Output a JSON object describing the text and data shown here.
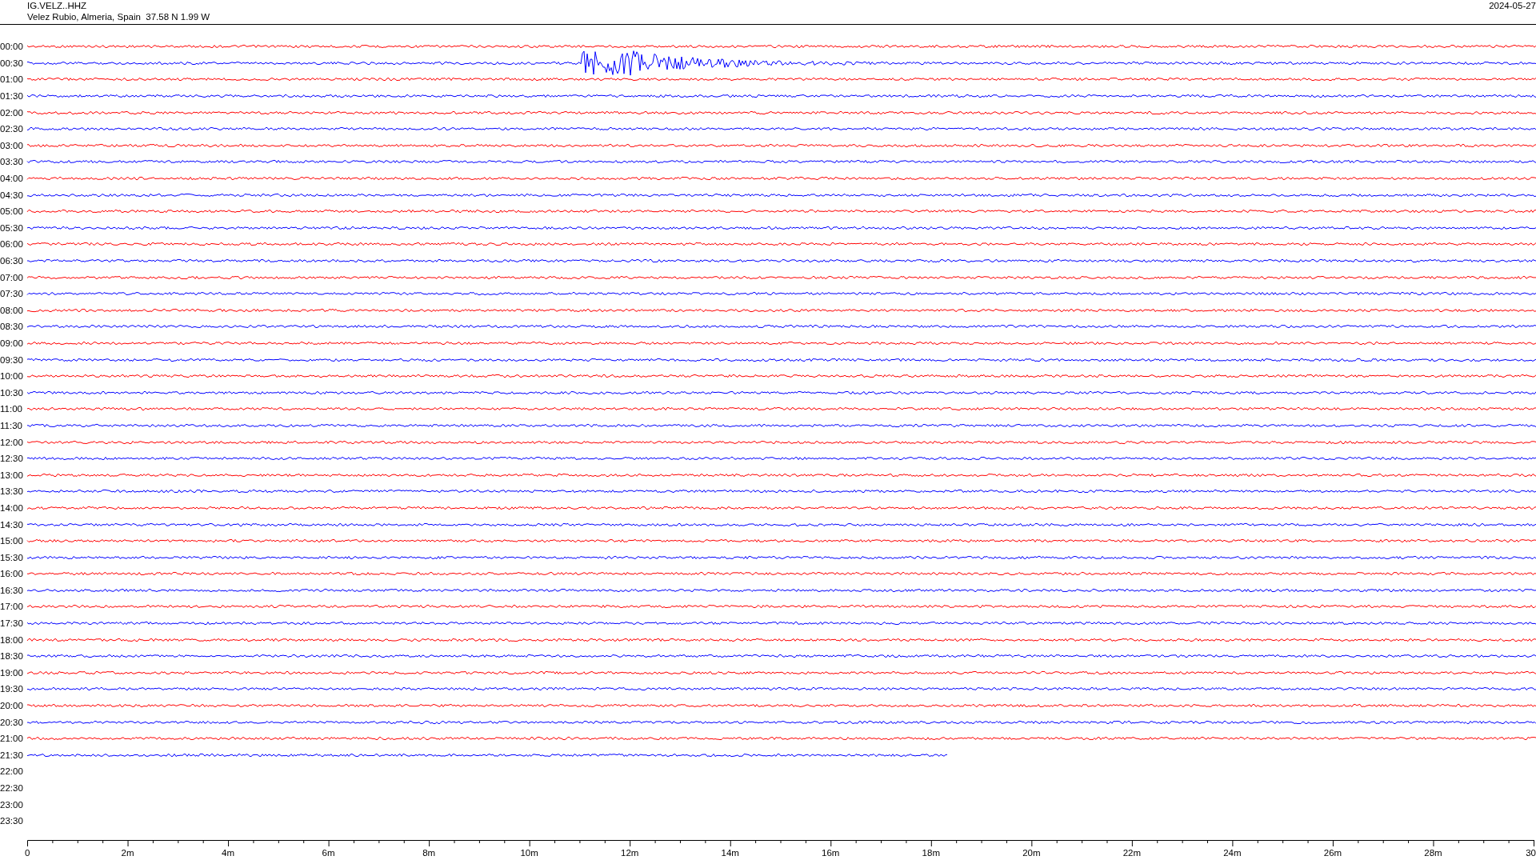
{
  "header": {
    "station": "IG.VELZ..HHZ",
    "location": "Velez Rubio, Almeria, Spain  37.58 N 1.99 W",
    "date": "2024-05-27"
  },
  "rows": [
    {
      "time": "00:00",
      "trace": {
        "color": "#ff0000",
        "level": 1,
        "event": false
      }
    },
    {
      "time": "00:30",
      "trace": {
        "color": "#0000ff",
        "level": 1,
        "event": true
      }
    },
    {
      "time": "01:00",
      "trace": {
        "color": "#ff0000",
        "level": 1,
        "event": false
      }
    },
    {
      "time": "01:30",
      "trace": {
        "color": "#0000ff",
        "level": 1,
        "event": false
      }
    },
    {
      "time": "02:00",
      "trace": {
        "color": "#ff0000",
        "level": 1,
        "event": false
      }
    },
    {
      "time": "02:30",
      "trace": {
        "color": "#0000ff",
        "level": 1,
        "event": false
      }
    },
    {
      "time": "03:00",
      "trace": {
        "color": "#ff0000",
        "level": 1,
        "event": false
      }
    },
    {
      "time": "03:30",
      "trace": {
        "color": "#0000ff",
        "level": 1,
        "event": false
      }
    },
    {
      "time": "04:00",
      "trace": {
        "color": "#ff0000",
        "level": 1,
        "event": false
      }
    },
    {
      "time": "04:30",
      "trace": {
        "color": "#0000ff",
        "level": 1,
        "event": false
      }
    },
    {
      "time": "05:00",
      "trace": {
        "color": "#ff0000",
        "level": 1,
        "event": false
      }
    },
    {
      "time": "05:30",
      "trace": {
        "color": "#0000ff",
        "level": 1,
        "event": false
      }
    },
    {
      "time": "06:00",
      "trace": {
        "color": "#ff0000",
        "level": 1,
        "event": false
      }
    },
    {
      "time": "06:30",
      "trace": {
        "color": "#0000ff",
        "level": 1,
        "event": false
      }
    },
    {
      "time": "07:00",
      "trace": {
        "color": "#ff0000",
        "level": 1,
        "event": false
      }
    },
    {
      "time": "07:30",
      "trace": {
        "color": "#0000ff",
        "level": 1,
        "event": false
      }
    },
    {
      "time": "08:00",
      "trace": {
        "color": "#ff0000",
        "level": 1,
        "event": false
      }
    },
    {
      "time": "08:30",
      "trace": {
        "color": "#0000ff",
        "level": 1,
        "event": false
      }
    },
    {
      "time": "09:00",
      "trace": {
        "color": "#ff0000",
        "level": 1,
        "event": false
      }
    },
    {
      "time": "09:30",
      "trace": {
        "color": "#0000ff",
        "level": 1,
        "event": false
      }
    },
    {
      "time": "10:00",
      "trace": {
        "color": "#ff0000",
        "level": 1,
        "event": false
      }
    },
    {
      "time": "10:30",
      "trace": {
        "color": "#0000ff",
        "level": 1,
        "event": false
      }
    },
    {
      "time": "11:00",
      "trace": {
        "color": "#ff0000",
        "level": 1,
        "event": false
      }
    },
    {
      "time": "11:30",
      "trace": {
        "color": "#0000ff",
        "level": 1,
        "event": false
      }
    },
    {
      "time": "12:00",
      "trace": {
        "color": "#ff0000",
        "level": 1,
        "event": false
      }
    },
    {
      "time": "12:30",
      "trace": {
        "color": "#0000ff",
        "level": 1,
        "event": false
      }
    },
    {
      "time": "13:00",
      "trace": {
        "color": "#ff0000",
        "level": 1,
        "event": false
      }
    },
    {
      "time": "13:30",
      "trace": {
        "color": "#0000ff",
        "level": 1,
        "event": false
      }
    },
    {
      "time": "14:00",
      "trace": {
        "color": "#ff0000",
        "level": 1,
        "event": false
      }
    },
    {
      "time": "14:30",
      "trace": {
        "color": "#0000ff",
        "level": 1,
        "event": false
      }
    },
    {
      "time": "15:00",
      "trace": {
        "color": "#ff0000",
        "level": 1,
        "event": false
      }
    },
    {
      "time": "15:30",
      "trace": {
        "color": "#0000ff",
        "level": 1,
        "event": false
      }
    },
    {
      "time": "16:00",
      "trace": {
        "color": "#ff0000",
        "level": 1,
        "event": false
      }
    },
    {
      "time": "16:30",
      "trace": {
        "color": "#0000ff",
        "level": 1,
        "event": false
      }
    },
    {
      "time": "17:00",
      "trace": {
        "color": "#ff0000",
        "level": 1,
        "event": false
      }
    },
    {
      "time": "17:30",
      "trace": {
        "color": "#0000ff",
        "level": 1,
        "event": false
      }
    },
    {
      "time": "18:00",
      "trace": {
        "color": "#ff0000",
        "level": 1,
        "event": false
      }
    },
    {
      "time": "18:30",
      "trace": {
        "color": "#0000ff",
        "level": 1,
        "event": false
      }
    },
    {
      "time": "19:00",
      "trace": {
        "color": "#ff0000",
        "level": 1,
        "event": false
      }
    },
    {
      "time": "19:30",
      "trace": {
        "color": "#0000ff",
        "level": 1,
        "event": false
      }
    },
    {
      "time": "20:00",
      "trace": {
        "color": "#ff0000",
        "level": 1,
        "event": false
      }
    },
    {
      "time": "20:30",
      "trace": {
        "color": "#0000ff",
        "level": 1,
        "event": false
      }
    },
    {
      "time": "21:00",
      "trace": {
        "color": "#ff0000",
        "level": 1,
        "event": false
      }
    },
    {
      "time": "21:30",
      "trace": {
        "color": "#0000ff",
        "level": 0.61,
        "event": false
      }
    },
    {
      "time": "22:00"
    },
    {
      "time": "22:30"
    },
    {
      "time": "23:00"
    },
    {
      "time": "23:30"
    }
  ],
  "axis": {
    "labels": [
      "0",
      "2m",
      "4m",
      "6m",
      "8m",
      "10m",
      "12m",
      "14m",
      "16m",
      "18m",
      "20m",
      "22m",
      "24m",
      "26m",
      "28m",
      "30"
    ]
  }
}
